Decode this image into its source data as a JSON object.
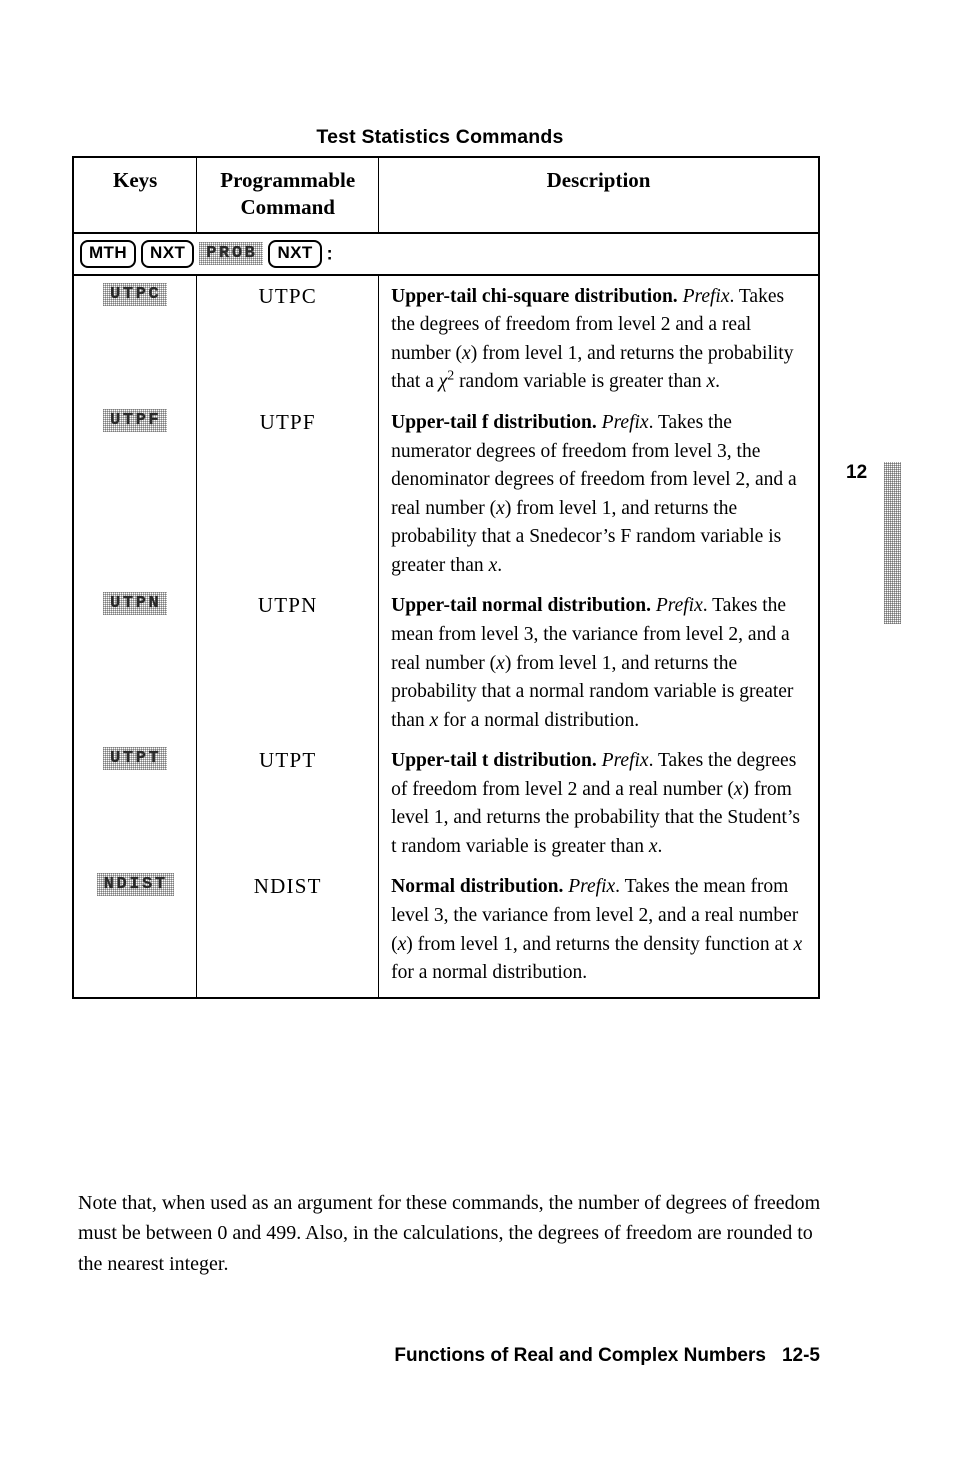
{
  "document": {
    "title": "Test Statistics Commands",
    "chapter_number": "12"
  },
  "table": {
    "headers": {
      "keys": "Keys",
      "programmable_command_line1": "Programmable",
      "programmable_command_line2": "Command",
      "description": "Description"
    },
    "keypath": {
      "keycap1": "MTH",
      "keycap2": "NXT",
      "softkey": "PROB",
      "keycap3": "NXT",
      "colon": ":"
    },
    "rows": [
      {
        "key_label": "UTPC",
        "command": "UTPC",
        "lead": "Upper-tail chi-square distribution.",
        "prefix": "Prefix",
        "body_part1": ". Takes the degrees of freedom from level 2 and a real number (",
        "var1": "x",
        "body_part2": ") from level 1, and returns the probability that a ",
        "chi": "χ",
        "chi_exp": "2",
        "body_part3": " random variable is greater than ",
        "var2": "x",
        "body_part4": "."
      },
      {
        "key_label": "UTPF",
        "command": "UTPF",
        "lead": "Upper-tail f distribution.",
        "prefix": "Prefix",
        "body_part1": ". Takes the numerator degrees of freedom from level 3, the denominator degrees of freedom from level 2, and a real number (",
        "var1": "x",
        "body_part2": ") from level 1, and returns the probability that a Snedecor’s F random variable is greater than ",
        "var2": "x",
        "body_part3": "."
      },
      {
        "key_label": "UTPN",
        "command": "UTPN",
        "lead": "Upper-tail normal distribution.",
        "prefix": "Prefix",
        "body_part1": ". Takes the mean from level 3, the variance from level 2, and a real number (",
        "var1": "x",
        "body_part2": ") from level 1, and returns the probability that a normal random variable is greater than ",
        "var2": "x",
        "body_part3": " for a normal distribution."
      },
      {
        "key_label": "UTPT",
        "command": "UTPT",
        "lead": "Upper-tail t distribution.",
        "prefix": "Prefix",
        "body_part1": ". Takes the degrees of freedom from level 2 and a real number (",
        "var1": "x",
        "body_part2": ") from level 1, and returns the probability that the Student’s t random variable is greater than ",
        "var2": "x",
        "body_part3": "."
      },
      {
        "key_label": "NDIST",
        "command": "NDIST",
        "lead": "Normal distribution.",
        "prefix": "Prefix",
        "body_part1": ". Takes the mean from level 3, the variance from level 2, and a real number (",
        "var1": "x",
        "body_part2": ") from level 1, and returns the density function at ",
        "var2": "x",
        "body_part3": " for a normal distribution."
      }
    ]
  },
  "note": {
    "text": "Note that, when used as an argument for these commands, the number of degrees of freedom must be between 0 and 499.  Also, in the calculations, the degrees of freedom are rounded to the nearest integer."
  },
  "footer": {
    "title": "Functions of Real and Complex Numbers",
    "page": "12-5"
  }
}
